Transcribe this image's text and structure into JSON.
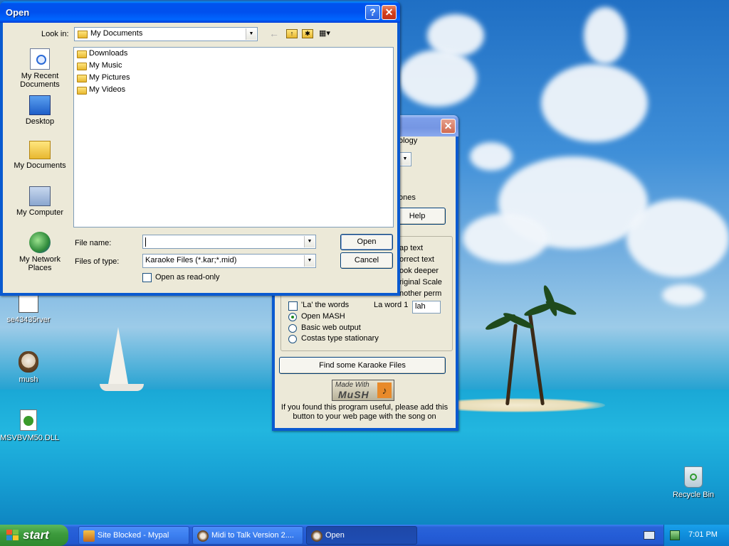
{
  "desktop": {
    "icons": [
      {
        "label": "se43435rver"
      },
      {
        "label": "mush"
      },
      {
        "label": "MSVBVM50.DLL"
      },
      {
        "label": "Recycle Bin"
      }
    ]
  },
  "open_dialog": {
    "title": "Open",
    "look_in_label": "Look in:",
    "look_in_value": "My Documents",
    "places": [
      {
        "label": "My Recent Documents"
      },
      {
        "label": "Desktop"
      },
      {
        "label": "My Documents"
      },
      {
        "label": "My Computer"
      },
      {
        "label": "My Network Places"
      }
    ],
    "files": [
      {
        "name": "Downloads"
      },
      {
        "name": "My Music"
      },
      {
        "name": "My Pictures"
      },
      {
        "name": "My Videos"
      }
    ],
    "file_name_label": "File name:",
    "file_name_value": "",
    "file_type_label": "Files of type:",
    "file_type_value": "Karaoke Files (*.kar;*.mid)",
    "read_only_label": "Open as read-only",
    "open_button": "Open",
    "cancel_button": "Cancel"
  },
  "midi_window": {
    "partial_texts": [
      "ology",
      "ones"
    ],
    "help_button": "Help",
    "right_options": [
      "ap text",
      "orrect text",
      "ook deeper",
      "riginal Scale",
      "nother perm"
    ],
    "left_partial_option": "Yet another perm",
    "la_the_words_label": "'La' the words",
    "la_word_label": "La word 1",
    "la_word_value": "lah",
    "radio_options": [
      {
        "label": "Open MASH",
        "selected": true
      },
      {
        "label": "Basic web output",
        "selected": false
      },
      {
        "label": "Costas type stationary",
        "selected": false
      }
    ],
    "find_button": "Find some Karaoke Files",
    "made_with_line1": "Made With",
    "made_with_line2": "MuSH",
    "footer_text": "If you found this program useful, please add this button to your web page with the song on"
  },
  "taskbar": {
    "start_label": "start",
    "tasks": [
      {
        "label": "Site Blocked - Mypal"
      },
      {
        "label": "Midi to Talk Version 2...."
      },
      {
        "label": "Open"
      }
    ],
    "clock": "7:01 PM"
  }
}
